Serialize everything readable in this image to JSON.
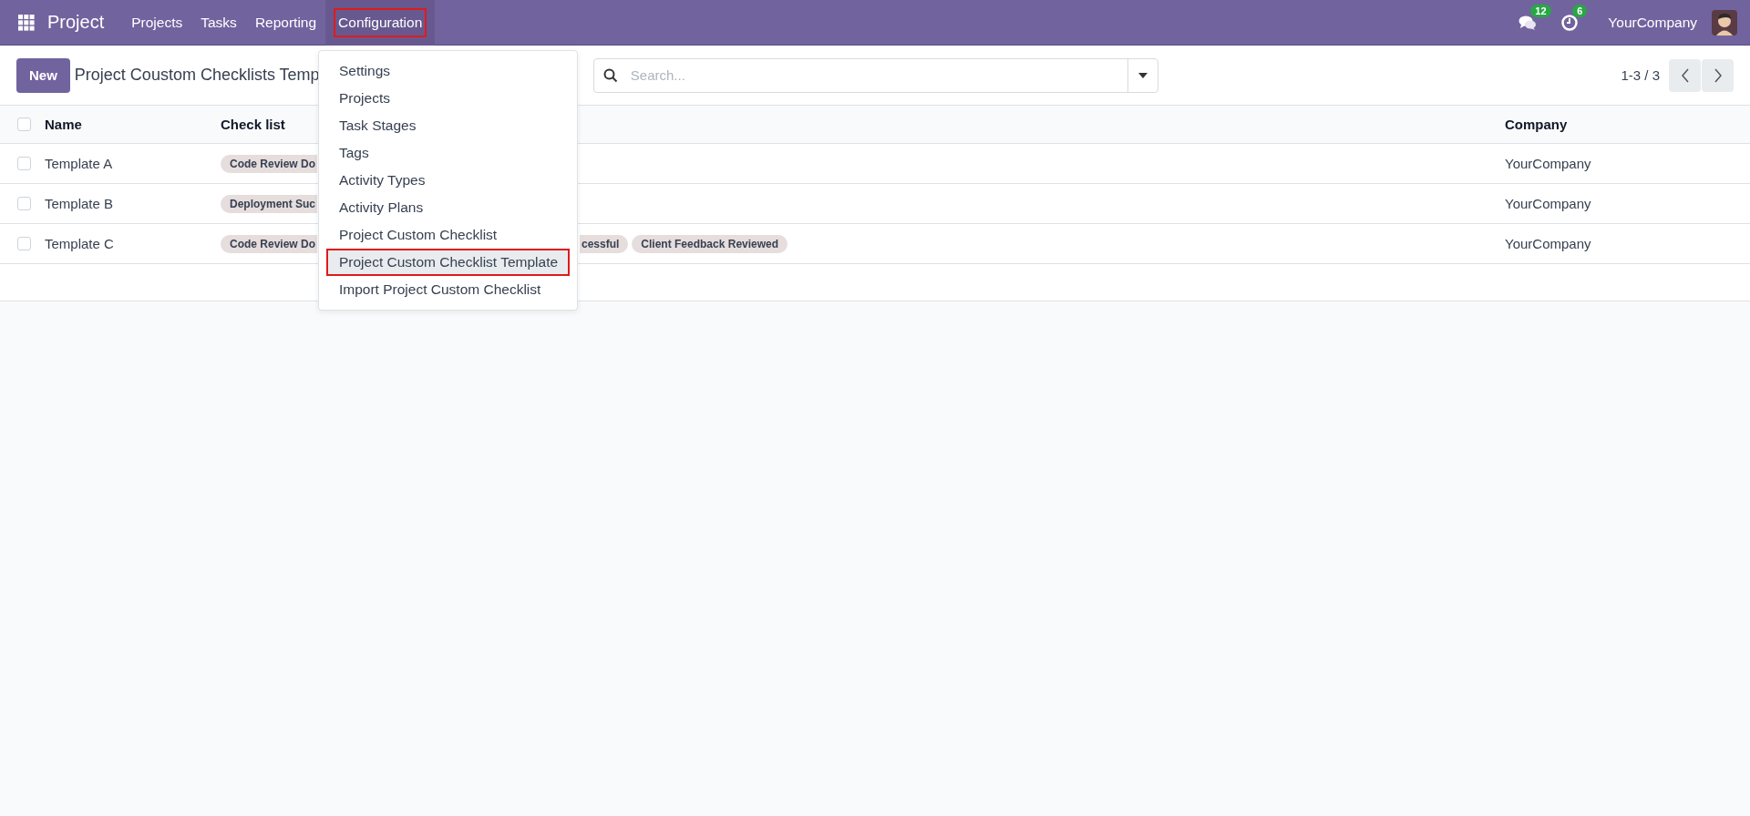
{
  "navbar": {
    "app_name": "Project",
    "menus": [
      {
        "label": "Projects",
        "selected": false
      },
      {
        "label": "Tasks",
        "selected": false
      },
      {
        "label": "Reporting",
        "selected": false
      },
      {
        "label": "Configuration",
        "selected": true
      }
    ],
    "messages_badge": "12",
    "activities_badge": "6",
    "company": "YourCompany"
  },
  "control_panel": {
    "new_button": "New",
    "title": "Project Coustom Checklists Temp",
    "search": {
      "placeholder": "Search..."
    },
    "pager": "1-3 / 3"
  },
  "table": {
    "all_checked": false,
    "columns": [
      "Name",
      "Check list",
      "Company"
    ],
    "rows": [
      {
        "name": "Template A",
        "checklist": [
          "Code Review Do"
        ],
        "company": "YourCompany",
        "checked": false
      },
      {
        "name": "Template B",
        "checklist": [
          "Deployment Suc"
        ],
        "company": "YourCompany",
        "checked": false
      },
      {
        "name": "Template C",
        "checklist": [
          "Code Review Do",
          "cessful",
          "Client Feedback Reviewed"
        ],
        "company": "YourCompany",
        "checked": false
      }
    ]
  },
  "dropdown_menu": {
    "items": [
      {
        "label": "Settings",
        "selected": false
      },
      {
        "label": "Projects",
        "selected": false
      },
      {
        "label": "Task Stages",
        "selected": false
      },
      {
        "label": "Tags",
        "selected": false
      },
      {
        "label": "Activity Types",
        "selected": false
      },
      {
        "label": "Activity Plans",
        "selected": false
      },
      {
        "label": "Project Custom Checklist",
        "selected": false
      },
      {
        "label": "Project Custom Checklist Template",
        "selected": true
      },
      {
        "label": "Import Project Custom Checklist",
        "selected": false
      }
    ]
  }
}
